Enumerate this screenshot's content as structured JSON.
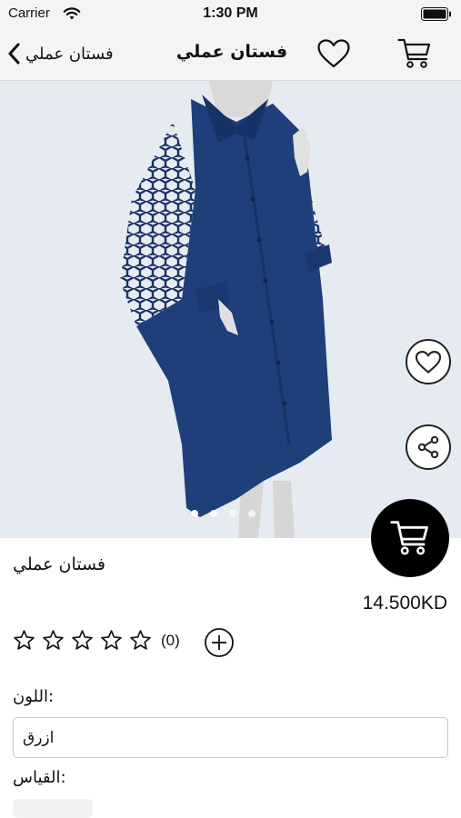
{
  "status_bar": {
    "carrier": "Carrier",
    "time": "1:30 PM"
  },
  "nav": {
    "back_label": "فستان عملي",
    "title": "فستان عملي",
    "icons": [
      "chevron-left-icon",
      "heart-icon",
      "cart-icon"
    ]
  },
  "gallery": {
    "page_count": 4,
    "active_index": 0,
    "image_description_icon": "dress-photo"
  },
  "product": {
    "name": "فستان عملي",
    "price": "14.500KD",
    "rating": {
      "stars": 0,
      "max": 5,
      "count_text": "(0)"
    },
    "color_label": "اللون:",
    "color_value": "ازرق",
    "size_label": "القياس:"
  },
  "colors": {
    "dress": "#1f3f7a",
    "accent": "#000000",
    "background": "#e4eaf0"
  }
}
